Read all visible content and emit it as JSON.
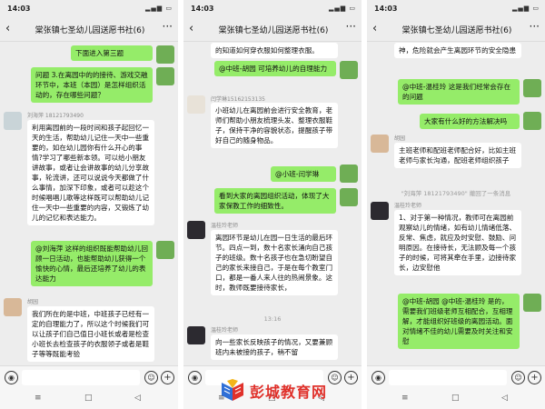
{
  "status_time": "14:03",
  "chat_title": "棠张镇七圣幼儿园送愿书社(6)",
  "watermark_text": "彭城教育网",
  "colors": {
    "bubble_self": "#95ec69",
    "bubble_other": "#ffffff",
    "background": "#ededed",
    "watermark": "#e0312b"
  },
  "icons": [
    "back-arrow-icon",
    "more-icon",
    "voice-icon",
    "emoji-icon",
    "plus-icon"
  ],
  "phone1": {
    "m1": "下面进入第三题",
    "m2": "问题 3.在离园中的的接待、游戏交融环节中，本班（本园）是怎样组织活动的，存在哪些问题？",
    "n3": "刘海萍 18121793490",
    "m3": "利用离园前的一段时间和孩子起回忆一天的生活，帮助幼儿记住一天中一些重要的，如在幼儿园你有什么开心的事情?学习了哪些新本领。可以给小朋友讲故事，或者让会讲故事的幼儿分享故事，轮流讲，还可以说说今天都做了什么事情，加深下印象，或者可以趁这个时候唱唱儿歌等这样既可以帮助幼儿记住一天中一些重要的内容，又锻炼了幼儿的记忆和表达能力。",
    "m4": "@刘海萍 这样的组织既能帮助幼儿回顾一日活动，也能帮助幼儿获得一个愉快的心情，最后还培养了幼儿的表达能力",
    "n5": "胡园",
    "m5": "我们所在的是中班，中班孩子已经有一定的自理能力了，所以这个时候我们可以让孩子们自己值日小班长或者是检查小班长去检查孩子的衣服领子或者是鞋子等等既能考验"
  },
  "phone2": {
    "m1": "的知道如何穿衣服如何整理衣服。",
    "m2": "@中班-胡园 可培养幼儿的自理能力",
    "n3": "闫学琳15162153135",
    "m3": "小班幼儿在离园前会进行安全教育，老师们帮助小朋友梳理头发、整理衣服鞋子，保持干净的容貌状态，提醒孩子带好自己的随身物品。",
    "m4": "@小班-闫学琳",
    "m5": "看到大家的离园组织活动，体现了大家保教工作的细致性。",
    "n6": "温桂玲老师",
    "m6": "离园环节是幼儿在园一日生活的最后环节。四点一到，数十名家长涌向自己孩子的班级。数十名孩子也在急切盼望自己的家长来接自己，于是在每个教室门口，都是一番人来人往的热闹景象。这时，教师既要接待家长，",
    "time": "13:16",
    "n7": "温桂玲老师",
    "m7": "向一些家长反映孩子的情况，又要兼顾班内未被接的孩子，稍不留"
  },
  "phone3": {
    "m1": "神，危险就会产生离园环节的安全隐患",
    "m2": "@中班-温桂玲 这是我们经常会存在的问题",
    "m3": "大家有什么好的方法解决吗",
    "n4": "胡园",
    "m4": "主班老师和配班老师配合好，比如主班老师与家长沟通，配班老师组织孩子",
    "note": "\"刘海萍 18121793490\" 撤回了一条消息",
    "n5": "温桂玲老师",
    "m5": "1、对于第一种情况，教师可在离园前观察幼儿的情绪，如有幼儿情绪低落、反常、焦虑，就应及时安慰、鼓励、问明原因。在接待长，无法顾及每一个孩子的时候，可将其牵在手里，边接待家长，边安慰他",
    "m6": "@中班-胡园 @中班-温桂玲 是的，需要我们班级老师互相配合，互相理解，才能组织好班级的离园活动。面对情绪不佳的幼儿需要及时关注和安慰"
  }
}
